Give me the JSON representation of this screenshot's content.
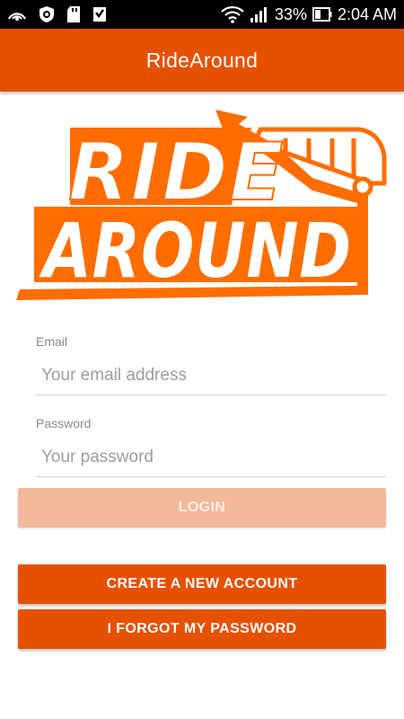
{
  "status_bar": {
    "battery": "33%",
    "time": "2:04 AM",
    "left_icons": [
      "hotspot-icon",
      "shield-icon",
      "sd-card-icon",
      "download-icon"
    ],
    "right_icons": [
      "wifi-icon",
      "signal-icon",
      "battery-icon"
    ]
  },
  "app_bar": {
    "title": "RideAround"
  },
  "logo": {
    "line1": "RIDE",
    "line2": "AROUND"
  },
  "form": {
    "email": {
      "label": "Email",
      "placeholder": "Your email address",
      "value": ""
    },
    "password": {
      "label": "Password",
      "placeholder": "Your password",
      "value": ""
    }
  },
  "buttons": {
    "login": "LOGIN",
    "create_account": "CREATE A NEW ACCOUNT",
    "forgot_password": "I FORGOT MY PASSWORD"
  },
  "colors": {
    "accent": "#e65100",
    "logo": "#ff6d00",
    "login_disabled": "#f3b99b"
  }
}
